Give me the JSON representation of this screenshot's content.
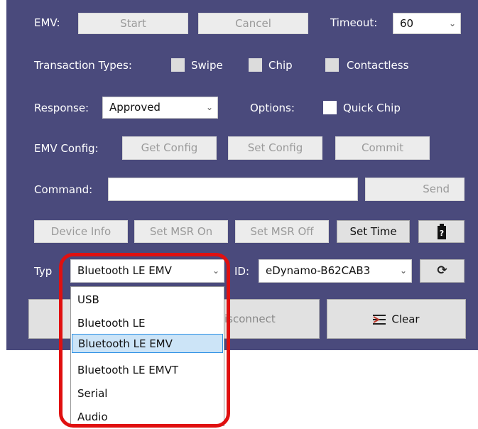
{
  "emv": {
    "label": "EMV:",
    "start": "Start",
    "cancel": "Cancel",
    "timeout_label": "Timeout:",
    "timeout_value": "60"
  },
  "transaction_types": {
    "label": "Transaction Types:",
    "swipe": "Swipe",
    "chip": "Chip",
    "contactless": "Contactless"
  },
  "response": {
    "label": "Response:",
    "value": "Approved",
    "options_label": "Options:",
    "quick_chip": "Quick Chip"
  },
  "emv_config": {
    "label": "EMV Config:",
    "get": "Get Config",
    "set": "Set Config",
    "commit": "Commit"
  },
  "command": {
    "label": "Command:",
    "value": "",
    "send": "Send"
  },
  "device_row": {
    "device_info": "Device Info",
    "set_msr_on": "Set MSR On",
    "set_msr_off": "Set MSR Off",
    "set_time": "Set Time",
    "battery_icon": "battery-icon"
  },
  "type_row": {
    "type_label": "Typ",
    "type_value": "Bluetooth LE EMV",
    "id_label": "ID:",
    "device_value": "eDynamo-B62CAB3",
    "refresh_icon": "refresh-icon"
  },
  "actions": {
    "disconnect": "Disconnect",
    "disconnect_visible": "isconnect",
    "clear": "Clear",
    "clear_icon": "clear-list-icon"
  },
  "type_dropdown": {
    "options": [
      "USB",
      "Bluetooth LE",
      "Bluetooth LE EMV",
      "Bluetooth LE EMVT",
      "Serial",
      "Audio"
    ],
    "selected": "Bluetooth LE EMV"
  },
  "colors": {
    "panel": "#4a4a7c",
    "highlight": "#e01010",
    "selection": "#cce4f7"
  }
}
